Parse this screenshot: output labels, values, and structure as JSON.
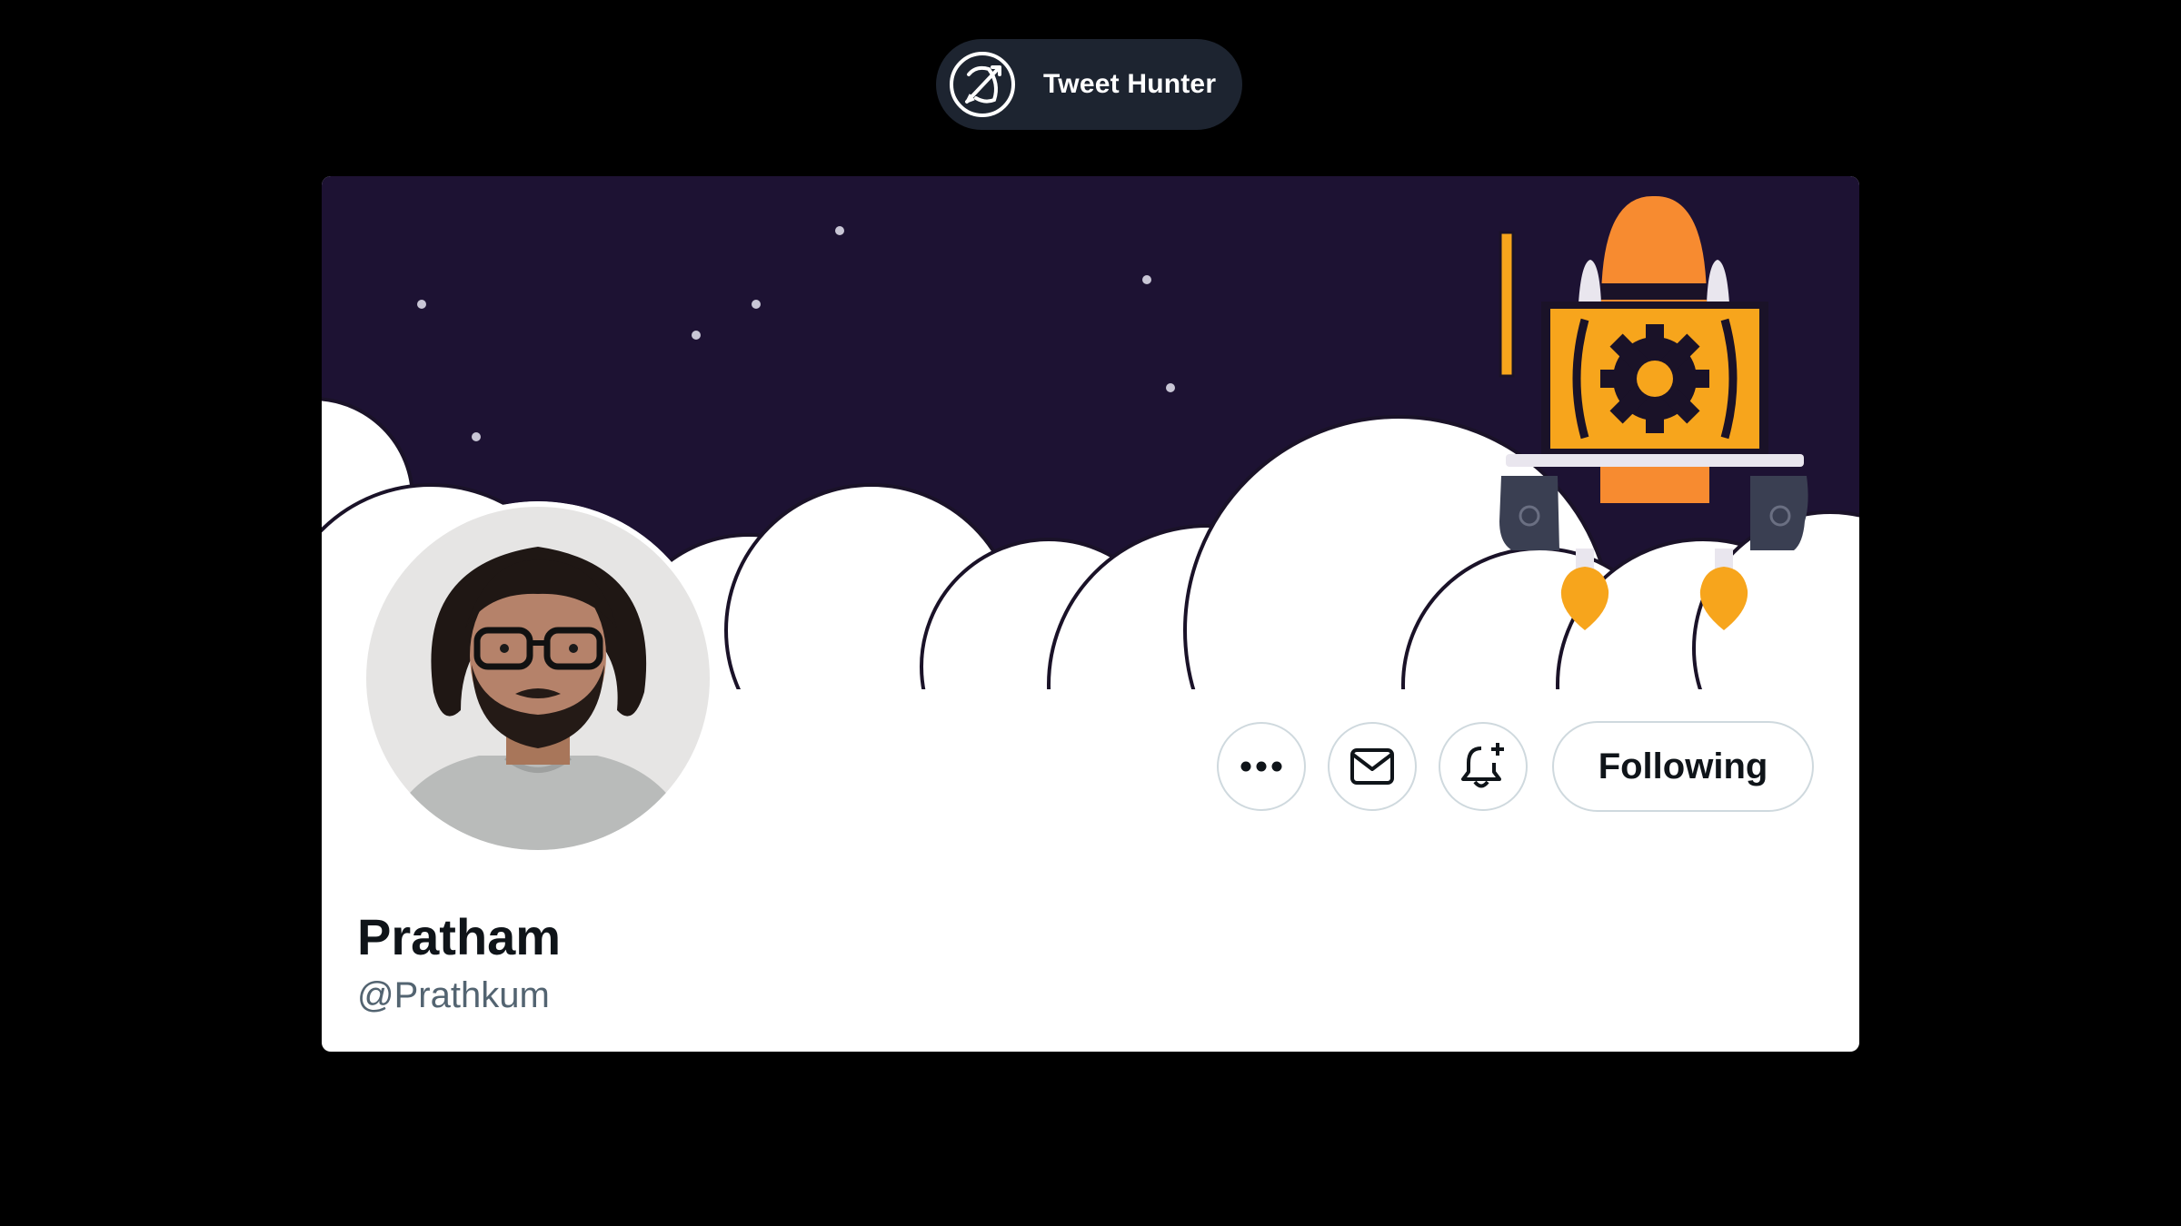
{
  "brand": {
    "name": "Tweet Hunter",
    "logo_icon": "bow-and-arrow-icon"
  },
  "profile": {
    "display_name": "Pratham",
    "handle": "@Prathkum",
    "banner": "night-sky-clouds-rocket-banner"
  },
  "actions": {
    "more_icon": "more-horizontal-icon",
    "message_icon": "envelope-icon",
    "notify_icon": "bell-plus-icon",
    "follow_label": "Following"
  },
  "colors": {
    "page_bg": "#000000",
    "pill_bg": "#1d2430",
    "banner_sky": "#1d1233",
    "rocket_orange": "#f7a51c",
    "text_primary": "#0f1419",
    "text_secondary": "#536471",
    "button_border": "#cfd9de"
  }
}
